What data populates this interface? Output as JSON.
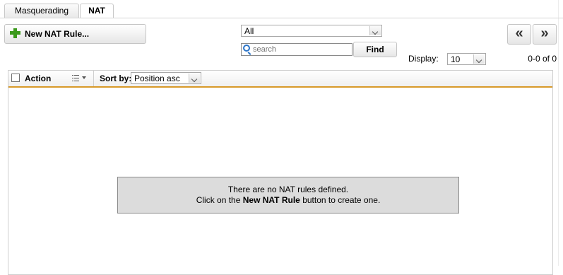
{
  "tabs": [
    {
      "label": "Masquerading"
    },
    {
      "label": "NAT"
    }
  ],
  "toolbar": {
    "new_rule_label": "New NAT Rule...",
    "filter_value": "All",
    "search_placeholder": "search",
    "find_label": "Find",
    "display_label": "Display:",
    "display_value": "10",
    "count_label": "0-0 of 0",
    "prev_glyph": "«",
    "next_glyph": "»"
  },
  "grid": {
    "action_label": "Action",
    "sort_label": "Sort by:",
    "sort_value": "Position asc"
  },
  "empty": {
    "line1": "There are no NAT rules defined.",
    "line2_pre": "Click on the ",
    "line2_bold": "New NAT Rule",
    "line2_post": " button to create one."
  },
  "colors": {
    "accent_line": "#d89a2a",
    "plus_icon": "#3c9a1c",
    "search_icon": "#2b74c7"
  }
}
